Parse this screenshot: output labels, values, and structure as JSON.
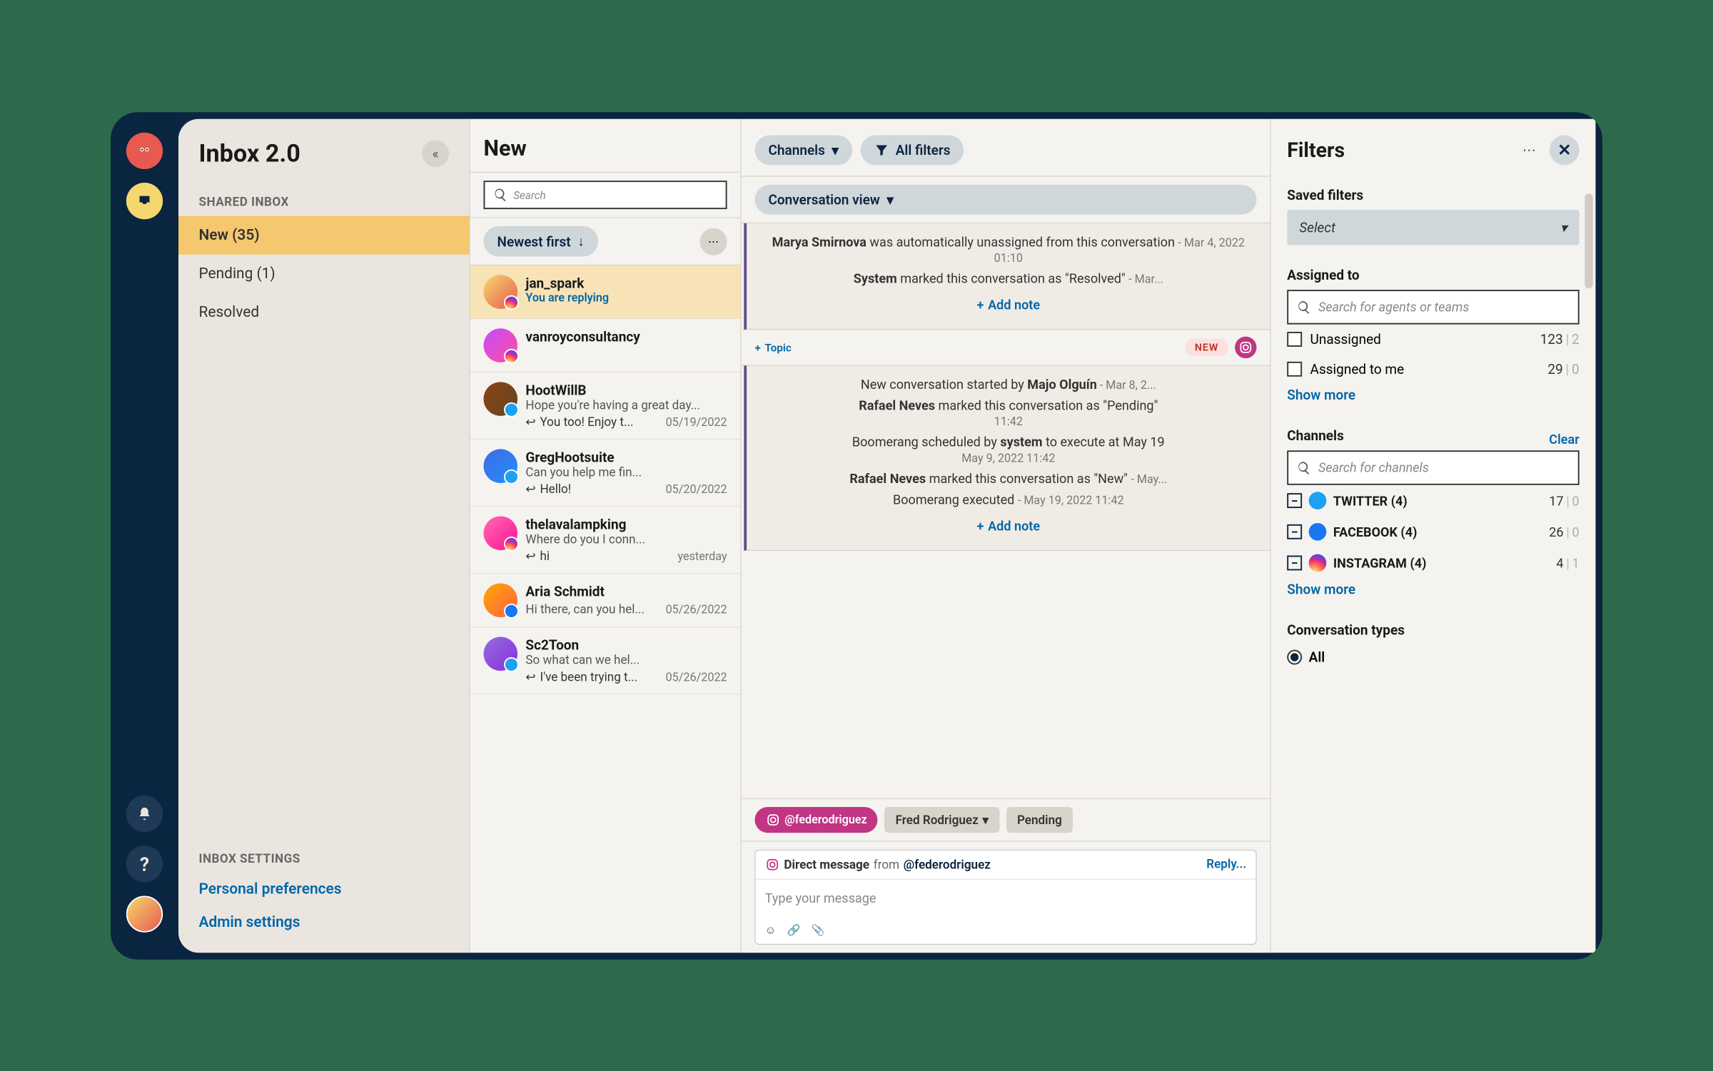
{
  "app_title": "Inbox 2.0",
  "sidebar": {
    "section_shared": "SHARED INBOX",
    "items": [
      {
        "label": "New  (35)",
        "active": true
      },
      {
        "label": "Pending (1)",
        "active": false
      },
      {
        "label": "Resolved",
        "active": false
      }
    ],
    "section_settings": "INBOX SETTINGS",
    "links": {
      "personal": "Personal preferences",
      "admin": "Admin settings"
    }
  },
  "main": {
    "title": "New",
    "search_placeholder": "Search",
    "channels_btn": "Channels",
    "filters_btn": "All filters",
    "sort_label": "Newest first",
    "view_label": "Conversation view"
  },
  "conversations": [
    {
      "name": "jan_spark",
      "replying": "You are replying",
      "network": "instagram"
    },
    {
      "name": "vanroyconsultancy",
      "network": "instagram"
    },
    {
      "name": "HootWillB",
      "preview": "Hope you're having a great day...",
      "reply": "You too! Enjoy t...",
      "date": "05/19/2022",
      "network": "twitter"
    },
    {
      "name": "GregHootsuite",
      "preview": "Can you help me fin...",
      "reply": "Hello!",
      "date": "05/20/2022",
      "network": "twitter"
    },
    {
      "name": "thelavalampking",
      "preview": "Where do you I conn...",
      "reply": "hi",
      "date": "yesterday",
      "network": "instagram"
    },
    {
      "name": "Aria Schmidt",
      "preview": "Hi there, can you hel...",
      "date": "05/26/2022",
      "network": "facebook"
    },
    {
      "name": "Sc2Toon",
      "preview": "So what can we hel...",
      "reply": "I've been trying t...",
      "date": "05/26/2022",
      "network": "twitter"
    }
  ],
  "activity": {
    "block1": [
      {
        "actor": "Marya Smirnova",
        "text": " was automatically unassigned from this conversation ",
        "ts": "- Mar 4, 2022 01:10"
      },
      {
        "actor": "System",
        "text": " marked this conversation as \"Resolved\" ",
        "ts": "- Mar..."
      }
    ],
    "add_note": "Add note",
    "topic_label": "Topic",
    "badge": "NEW",
    "block2": [
      {
        "pre": "New conversation started by ",
        "actor": "Majo Olguín",
        "ts": " - Mar 8, 2..."
      },
      {
        "actor": "Rafael Neves",
        "text": " marked this conversation as \"Pending\"",
        "ts": "11:42"
      },
      {
        "pre": "Boomerang scheduled by ",
        "actor": "system",
        "text": " to execute at May 19",
        "ts": "May 9, 2022 11:42"
      },
      {
        "actor": "Rafael Neves",
        "text": " marked this conversation as \"New\" ",
        "ts": "- May..."
      },
      {
        "text": "Boomerang  executed ",
        "ts": "- May 19, 2022 11:42"
      }
    ]
  },
  "reply": {
    "handle": "@federodriguez",
    "assignee": "Fred Rodriguez",
    "status": "Pending",
    "dm_label": "Direct message",
    "from_label": "from",
    "from_handle": "@federodriguez",
    "reply_type": "Reply...",
    "placeholder": "Type your message"
  },
  "filters": {
    "title": "Filters",
    "saved_label": "Saved filters",
    "saved_placeholder": "Select",
    "assigned_label": "Assigned to",
    "agents_placeholder": "Search for agents or teams",
    "unassigned_label": "Unassigned",
    "unassigned_count": "123",
    "unassigned_dim": "2",
    "assigned_me_label": "Assigned to me",
    "assigned_me_count": "29",
    "assigned_me_dim": "0",
    "show_more": "Show more",
    "channels_label": "Channels",
    "clear": "Clear",
    "channels_placeholder": "Search for channels",
    "channels": [
      {
        "name": "TWITTER (4)",
        "count": "17",
        "dim": "0",
        "network": "twitter"
      },
      {
        "name": "FACEBOOK (4)",
        "count": "26",
        "dim": "0",
        "network": "facebook"
      },
      {
        "name": "INSTAGRAM (4)",
        "count": "4",
        "dim": "1",
        "network": "instagram"
      }
    ],
    "types_label": "Conversation types",
    "all_label": "All"
  }
}
